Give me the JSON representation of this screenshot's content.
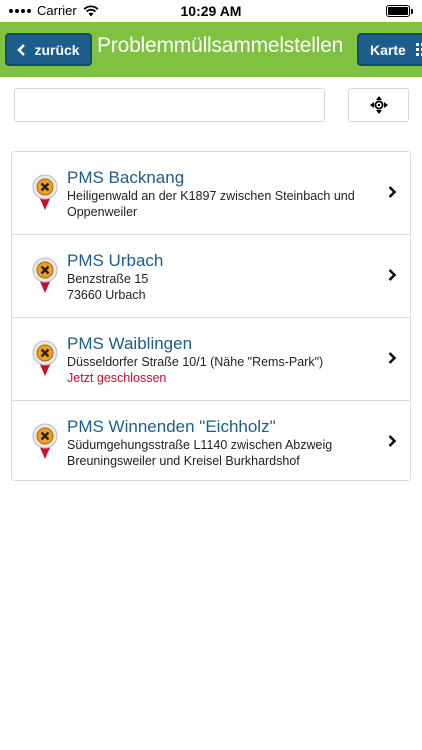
{
  "statusbar": {
    "carrier": "Carrier",
    "time": "10:29 AM"
  },
  "navbar": {
    "back_label": "zurück",
    "title": "Problemmüllsammelstellen",
    "map_label": "Karte",
    "accent_color": "#7fc241",
    "button_color": "#1c5d8c"
  },
  "search": {
    "value": "",
    "placeholder": ""
  },
  "locations": [
    {
      "title": "PMS Backnang",
      "line1": "Heiligenwald an der K1897 zwischen Steinbach und",
      "line2": "Oppenweiler",
      "status": ""
    },
    {
      "title": "PMS Urbach",
      "line1": "Benzstraße 15",
      "line2": "73660 Urbach",
      "status": ""
    },
    {
      "title": "PMS Waiblingen",
      "line1": "Düsseldorfer Straße 10/1 (Nähe \"Rems-Park\")",
      "line2": "",
      "status": "Jetzt geschlossen"
    },
    {
      "title": "PMS Winnenden \"Eichholz\"",
      "line1": "Südumgehungsstraße L1140 zwischen Abzweig",
      "line2": "Breuningsweiler und Kreisel Burkhardshof",
      "status": ""
    }
  ],
  "icons": {
    "pin": "location-pin-icon",
    "chevron": "chevron-right-icon",
    "locate": "crosshair-icon"
  }
}
